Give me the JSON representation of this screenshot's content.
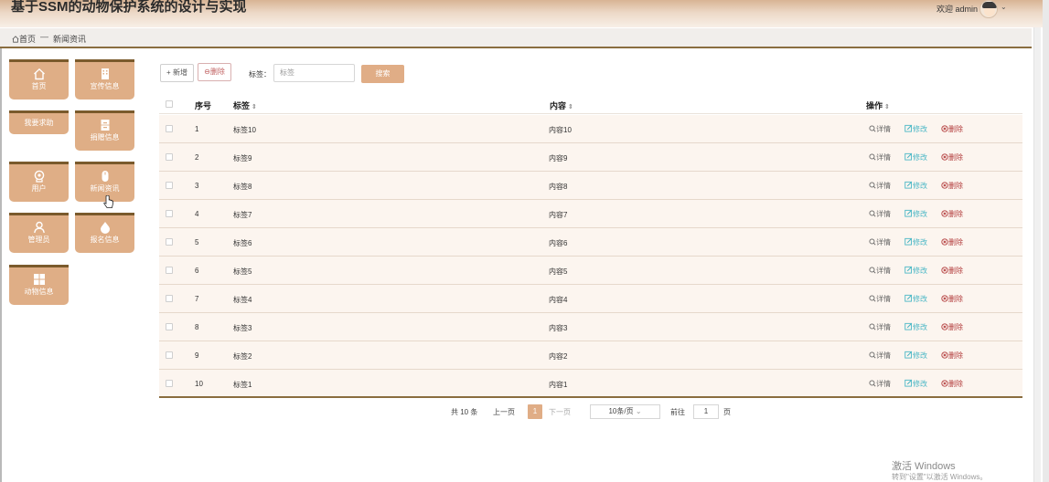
{
  "app": {
    "title": "基于SSM的动物保护系统的设计与实现",
    "welcome": "欢迎 admin"
  },
  "breadcrumb": {
    "home": "首页",
    "separator": "—",
    "current": "新闻资讯"
  },
  "sidebar": {
    "tiles": [
      {
        "label": "首页",
        "icon": "home-icon"
      },
      {
        "label": "宣传信息",
        "icon": "building-icon"
      },
      {
        "label": "我要求助",
        "icon": ""
      },
      {
        "label": "捐赠信息",
        "icon": "cabinet-icon"
      },
      {
        "label": "用户",
        "icon": "user-badge-icon"
      },
      {
        "label": "新闻资讯",
        "icon": "mouse-icon"
      },
      {
        "label": "管理员",
        "icon": "person-icon"
      },
      {
        "label": "报名信息",
        "icon": "drop-icon"
      },
      {
        "label": "动物信息",
        "icon": "grid-icon"
      }
    ]
  },
  "toolbar": {
    "add_label": "+ 新增",
    "delete_label": "⊖删除",
    "filter_label": "标签：",
    "search_placeholder": "标签",
    "search_label": "搜索"
  },
  "table": {
    "headers": {
      "index": "序号",
      "tag": "标签",
      "content": "内容",
      "actions": "操作"
    },
    "sort_glyph": "⇕",
    "action_labels": {
      "detail": "详情",
      "edit": "修改",
      "delete": "删除"
    },
    "rows": [
      {
        "index": "1",
        "tag": "标签10",
        "content": "内容10"
      },
      {
        "index": "2",
        "tag": "标签9",
        "content": "内容9"
      },
      {
        "index": "3",
        "tag": "标签8",
        "content": "内容8"
      },
      {
        "index": "4",
        "tag": "标签7",
        "content": "内容7"
      },
      {
        "index": "5",
        "tag": "标签6",
        "content": "内容6"
      },
      {
        "index": "6",
        "tag": "标签5",
        "content": "内容5"
      },
      {
        "index": "7",
        "tag": "标签4",
        "content": "内容4"
      },
      {
        "index": "8",
        "tag": "标签3",
        "content": "内容3"
      },
      {
        "index": "9",
        "tag": "标签2",
        "content": "内容2"
      },
      {
        "index": "10",
        "tag": "标签1",
        "content": "内容1"
      }
    ]
  },
  "pagination": {
    "total": "共 10 条",
    "prev": "上一页",
    "current": "1",
    "next": "下一页",
    "page_size": "10条/页",
    "goto_label": "前往",
    "goto_value": "1",
    "page_unit": "页"
  },
  "watermark": {
    "line1": "激活 Windows",
    "line2": "转到\"设置\"以激活 Windows。"
  },
  "colors": {
    "accent": "#e0ad86",
    "tile": "#dfae86",
    "border_brown": "#8a6d3f",
    "edit": "#4ab7c6",
    "delete": "#b23b3b"
  }
}
